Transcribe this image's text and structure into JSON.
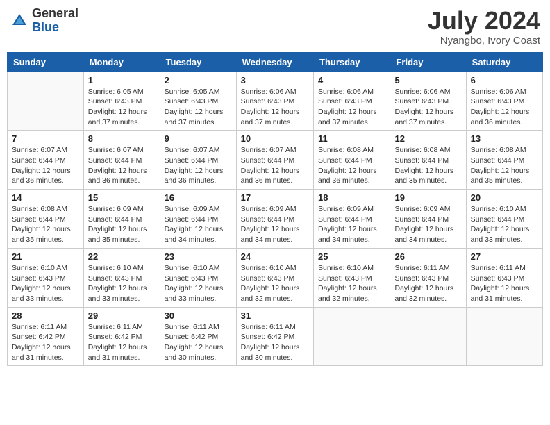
{
  "header": {
    "logo_general": "General",
    "logo_blue": "Blue",
    "month_year": "July 2024",
    "location": "Nyangbo, Ivory Coast"
  },
  "weekdays": [
    "Sunday",
    "Monday",
    "Tuesday",
    "Wednesday",
    "Thursday",
    "Friday",
    "Saturday"
  ],
  "weeks": [
    [
      {
        "day": "",
        "info": ""
      },
      {
        "day": "1",
        "info": "Sunrise: 6:05 AM\nSunset: 6:43 PM\nDaylight: 12 hours\nand 37 minutes."
      },
      {
        "day": "2",
        "info": "Sunrise: 6:05 AM\nSunset: 6:43 PM\nDaylight: 12 hours\nand 37 minutes."
      },
      {
        "day": "3",
        "info": "Sunrise: 6:06 AM\nSunset: 6:43 PM\nDaylight: 12 hours\nand 37 minutes."
      },
      {
        "day": "4",
        "info": "Sunrise: 6:06 AM\nSunset: 6:43 PM\nDaylight: 12 hours\nand 37 minutes."
      },
      {
        "day": "5",
        "info": "Sunrise: 6:06 AM\nSunset: 6:43 PM\nDaylight: 12 hours\nand 37 minutes."
      },
      {
        "day": "6",
        "info": "Sunrise: 6:06 AM\nSunset: 6:43 PM\nDaylight: 12 hours\nand 36 minutes."
      }
    ],
    [
      {
        "day": "7",
        "info": "Sunrise: 6:07 AM\nSunset: 6:44 PM\nDaylight: 12 hours\nand 36 minutes."
      },
      {
        "day": "8",
        "info": "Sunrise: 6:07 AM\nSunset: 6:44 PM\nDaylight: 12 hours\nand 36 minutes."
      },
      {
        "day": "9",
        "info": "Sunrise: 6:07 AM\nSunset: 6:44 PM\nDaylight: 12 hours\nand 36 minutes."
      },
      {
        "day": "10",
        "info": "Sunrise: 6:07 AM\nSunset: 6:44 PM\nDaylight: 12 hours\nand 36 minutes."
      },
      {
        "day": "11",
        "info": "Sunrise: 6:08 AM\nSunset: 6:44 PM\nDaylight: 12 hours\nand 36 minutes."
      },
      {
        "day": "12",
        "info": "Sunrise: 6:08 AM\nSunset: 6:44 PM\nDaylight: 12 hours\nand 35 minutes."
      },
      {
        "day": "13",
        "info": "Sunrise: 6:08 AM\nSunset: 6:44 PM\nDaylight: 12 hours\nand 35 minutes."
      }
    ],
    [
      {
        "day": "14",
        "info": "Sunrise: 6:08 AM\nSunset: 6:44 PM\nDaylight: 12 hours\nand 35 minutes."
      },
      {
        "day": "15",
        "info": "Sunrise: 6:09 AM\nSunset: 6:44 PM\nDaylight: 12 hours\nand 35 minutes."
      },
      {
        "day": "16",
        "info": "Sunrise: 6:09 AM\nSunset: 6:44 PM\nDaylight: 12 hours\nand 34 minutes."
      },
      {
        "day": "17",
        "info": "Sunrise: 6:09 AM\nSunset: 6:44 PM\nDaylight: 12 hours\nand 34 minutes."
      },
      {
        "day": "18",
        "info": "Sunrise: 6:09 AM\nSunset: 6:44 PM\nDaylight: 12 hours\nand 34 minutes."
      },
      {
        "day": "19",
        "info": "Sunrise: 6:09 AM\nSunset: 6:44 PM\nDaylight: 12 hours\nand 34 minutes."
      },
      {
        "day": "20",
        "info": "Sunrise: 6:10 AM\nSunset: 6:44 PM\nDaylight: 12 hours\nand 33 minutes."
      }
    ],
    [
      {
        "day": "21",
        "info": "Sunrise: 6:10 AM\nSunset: 6:43 PM\nDaylight: 12 hours\nand 33 minutes."
      },
      {
        "day": "22",
        "info": "Sunrise: 6:10 AM\nSunset: 6:43 PM\nDaylight: 12 hours\nand 33 minutes."
      },
      {
        "day": "23",
        "info": "Sunrise: 6:10 AM\nSunset: 6:43 PM\nDaylight: 12 hours\nand 33 minutes."
      },
      {
        "day": "24",
        "info": "Sunrise: 6:10 AM\nSunset: 6:43 PM\nDaylight: 12 hours\nand 32 minutes."
      },
      {
        "day": "25",
        "info": "Sunrise: 6:10 AM\nSunset: 6:43 PM\nDaylight: 12 hours\nand 32 minutes."
      },
      {
        "day": "26",
        "info": "Sunrise: 6:11 AM\nSunset: 6:43 PM\nDaylight: 12 hours\nand 32 minutes."
      },
      {
        "day": "27",
        "info": "Sunrise: 6:11 AM\nSunset: 6:43 PM\nDaylight: 12 hours\nand 31 minutes."
      }
    ],
    [
      {
        "day": "28",
        "info": "Sunrise: 6:11 AM\nSunset: 6:42 PM\nDaylight: 12 hours\nand 31 minutes."
      },
      {
        "day": "29",
        "info": "Sunrise: 6:11 AM\nSunset: 6:42 PM\nDaylight: 12 hours\nand 31 minutes."
      },
      {
        "day": "30",
        "info": "Sunrise: 6:11 AM\nSunset: 6:42 PM\nDaylight: 12 hours\nand 30 minutes."
      },
      {
        "day": "31",
        "info": "Sunrise: 6:11 AM\nSunset: 6:42 PM\nDaylight: 12 hours\nand 30 minutes."
      },
      {
        "day": "",
        "info": ""
      },
      {
        "day": "",
        "info": ""
      },
      {
        "day": "",
        "info": ""
      }
    ]
  ]
}
